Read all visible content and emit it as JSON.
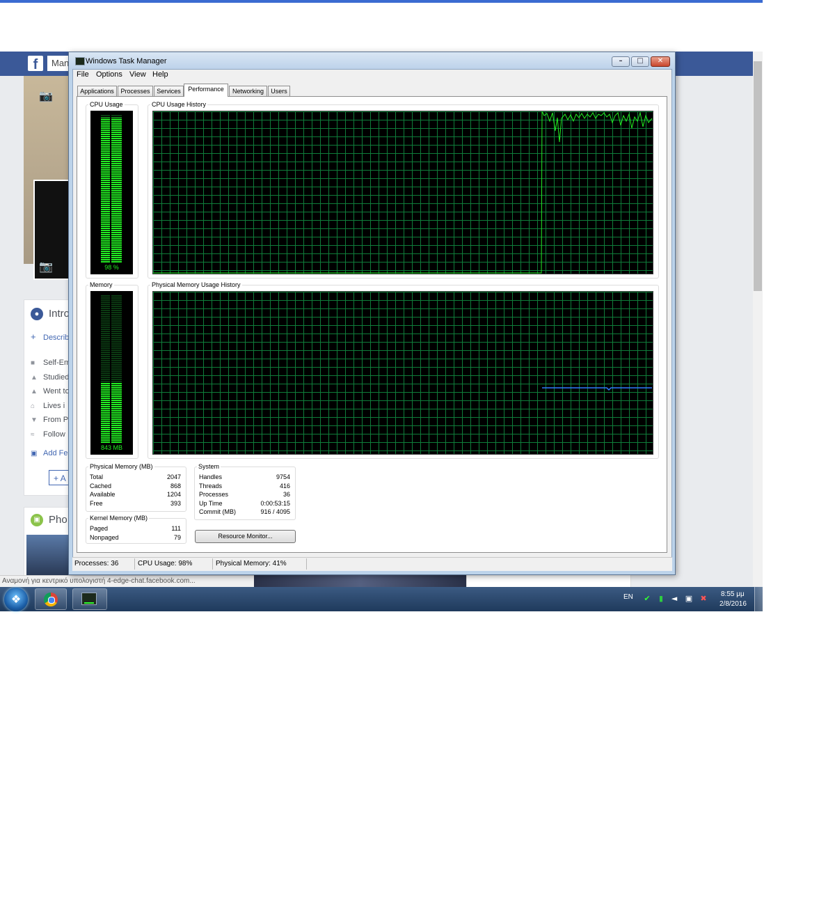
{
  "browser": {
    "status_url": "Αναμονή για κεντρικό υπολογιστή 4-edge-chat.facebook.com...",
    "accent_color": "#3b5998"
  },
  "facebook": {
    "logo": "f",
    "search_text": "Man",
    "intro_title": "Intro",
    "describe_link": "Describ",
    "intro_rows": [
      {
        "icon": "briefcase-icon",
        "text": "Self-Em"
      },
      {
        "icon": "graduation-cap-icon",
        "text": "Studied"
      },
      {
        "icon": "graduation-cap-icon",
        "text": "Went to"
      },
      {
        "icon": "house-icon",
        "text": "Lives i"
      },
      {
        "icon": "location-pin-icon",
        "text": "From P"
      },
      {
        "icon": "rss-icon",
        "text": "Follow"
      }
    ],
    "add_featured": "Add Fe",
    "add_button": "A",
    "photos_title": "Pho"
  },
  "taskbar": {
    "language": "EN",
    "time": "8:55 μμ",
    "date": "2/8/2016"
  },
  "task_manager": {
    "title": "Windows Task Manager",
    "menu": [
      "File",
      "Options",
      "View",
      "Help"
    ],
    "tabs": [
      "Applications",
      "Processes",
      "Services",
      "Performance",
      "Networking",
      "Users"
    ],
    "active_tab": "Performance",
    "cpu_usage": {
      "legend": "CPU Usage",
      "value_label": "98 %",
      "level": 0.98
    },
    "cpu_history": {
      "legend": "CPU Usage History"
    },
    "memory": {
      "legend": "Memory",
      "value_label": "843 MB",
      "level": 0.41
    },
    "memory_history": {
      "legend": "Physical Memory Usage History"
    },
    "physical_memory": {
      "legend": "Physical Memory (MB)",
      "rows": [
        {
          "label": "Total",
          "value": "2047"
        },
        {
          "label": "Cached",
          "value": "868"
        },
        {
          "label": "Available",
          "value": "1204"
        },
        {
          "label": "Free",
          "value": "393"
        }
      ]
    },
    "kernel_memory": {
      "legend": "Kernel Memory (MB)",
      "rows": [
        {
          "label": "Paged",
          "value": "111"
        },
        {
          "label": "Nonpaged",
          "value": "79"
        }
      ]
    },
    "system": {
      "legend": "System",
      "rows": [
        {
          "label": "Handles",
          "value": "9754"
        },
        {
          "label": "Threads",
          "value": "416"
        },
        {
          "label": "Processes",
          "value": "36"
        },
        {
          "label": "Up Time",
          "value": "0:00:53:15"
        },
        {
          "label": "Commit (MB)",
          "value": "916 / 4095"
        }
      ]
    },
    "resource_monitor_button": "Resource Monitor...",
    "statusbar": {
      "processes": "Processes: 36",
      "cpu": "CPU Usage: 98%",
      "memory": "Physical Memory: 41%"
    },
    "colors": {
      "cpu_line": "#22ee22",
      "memory_line": "#2f7dff",
      "grid": "#0f7d3a"
    }
  }
}
